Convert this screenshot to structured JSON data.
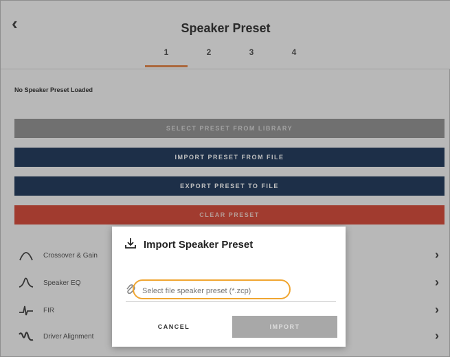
{
  "header": {
    "back_icon": "chevron-left-icon",
    "title": "Speaker Preset",
    "tabs": [
      {
        "label": "1",
        "active": true
      },
      {
        "label": "2",
        "active": false
      },
      {
        "label": "3",
        "active": false
      },
      {
        "label": "4",
        "active": false
      }
    ]
  },
  "status": "No Speaker Preset Loaded",
  "actions": {
    "select_library": "SELECT PRESET FROM LIBRARY",
    "import_file": "IMPORT PRESET FROM FILE",
    "export_file": "EXPORT PRESET TO FILE",
    "clear": "CLEAR PRESET"
  },
  "list": [
    {
      "label": "Crossover & Gain",
      "icon": "crossover-icon"
    },
    {
      "label": "Speaker EQ",
      "icon": "eq-icon"
    },
    {
      "label": "FIR",
      "icon": "fir-icon"
    },
    {
      "label": "Driver Alignment",
      "icon": "alignment-icon"
    }
  ],
  "dialog": {
    "title": "Import Speaker Preset",
    "title_icon": "download-icon",
    "file_icon": "paperclip-icon",
    "file_placeholder": "Select file speaker preset (*.zcp)",
    "cancel_label": "CANCEL",
    "import_label": "IMPORT"
  },
  "colors": {
    "accent": "#e07b3a",
    "navy": "#0f2a4f",
    "red": "#d13b2a",
    "highlight": "#f0a530"
  }
}
